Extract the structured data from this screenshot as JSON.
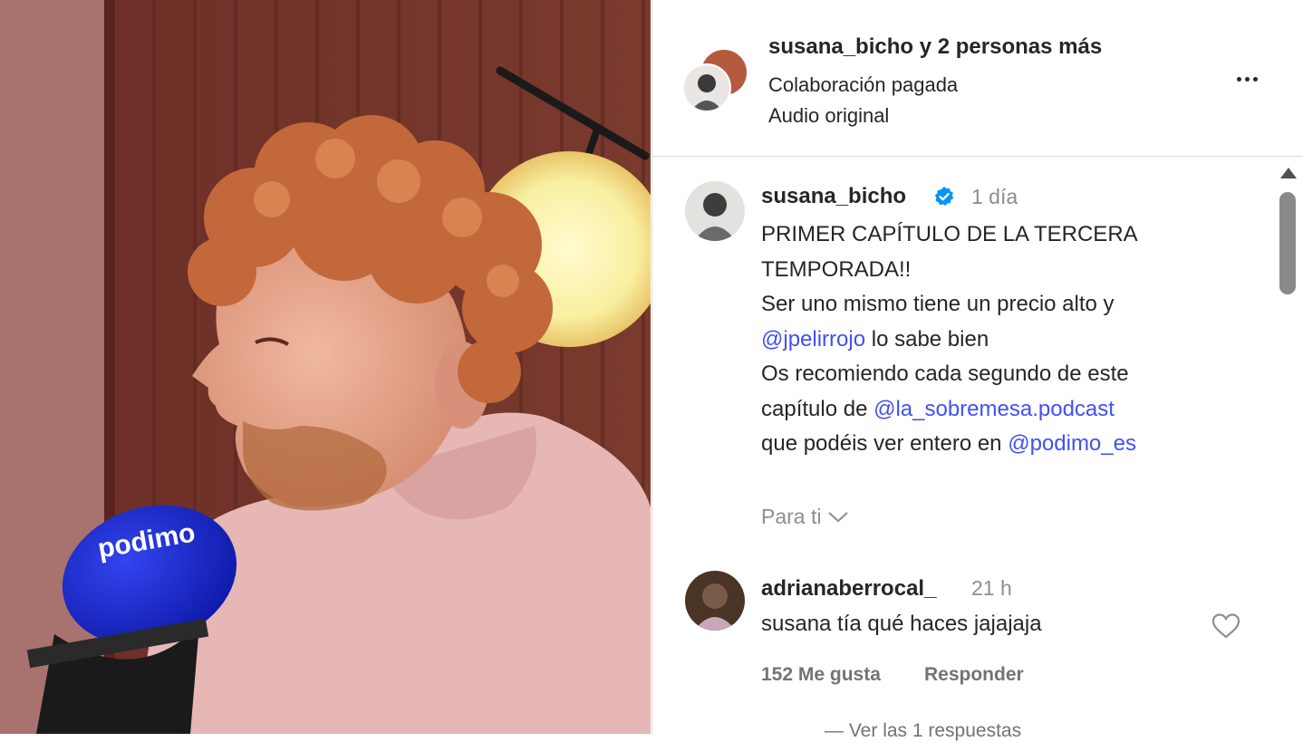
{
  "header": {
    "username": "susana_bicho",
    "collab_suffix": " y 2 personas más",
    "paid_label": "Colaboración pagada",
    "audio_label": "Audio original",
    "more_icon": "more-horizontal-icon"
  },
  "caption": {
    "username": "susana_bicho",
    "verified_icon": "verified-badge-icon",
    "time": "1 día",
    "line1": "PRIMER CAPÍTULO DE LA TERCERA",
    "line2": "TEMPORADA!!",
    "line3": "Ser uno mismo tiene un precio alto y",
    "mention1": "@jpelirrojo",
    "line4_rest": " lo sabe bien",
    "line5": "Os recomiendo cada segundo de este",
    "line6_pre": "capítulo de ",
    "mention2": "@la_sobremesa.podcast",
    "line7_pre": "que podéis ver entero en ",
    "mention3": "@podimo_es",
    "mention_color": "#4150f7"
  },
  "feed_filter": {
    "label": "Para ti",
    "icon": "chevron-down-icon"
  },
  "comment": {
    "username": "adrianaberrocal_",
    "time": "21 h",
    "text": "susana tía qué haces jajajaja",
    "likes": "152 Me gusta",
    "reply": "Responder",
    "like_icon": "heart-icon",
    "view_replies": "— Ver las 1 respuestas"
  },
  "media": {
    "mic_brand": "podimo",
    "mic_color": "#1a2ad6"
  }
}
